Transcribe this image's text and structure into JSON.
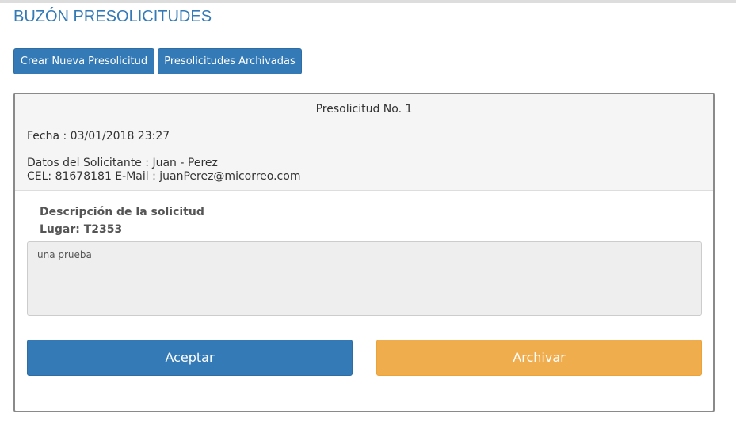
{
  "page": {
    "title": "BUZÓN PRESOLICITUDES"
  },
  "toolbar": {
    "new_label": "Crear Nueva Presolicitud",
    "archived_label": "Presolicitudes Archivadas"
  },
  "request": {
    "heading": "Presolicitud No. 1",
    "fecha": "Fecha : 03/01/2018 23:27",
    "solicitante": "Datos del Solicitante : Juan - Perez",
    "contacto": "CEL: 81678181 E-Mail : juanPerez@micorreo.com",
    "descripcion_label": "Descripción de la solicitud",
    "lugar_label": "Lugar: T2353",
    "descripcion_text": "una prueba",
    "accept_label": "Aceptar",
    "archive_label": "Archivar"
  },
  "colors": {
    "primary": "#337ab7",
    "warning": "#f0ad4e",
    "panel_heading_bg": "#f5f5f5"
  }
}
